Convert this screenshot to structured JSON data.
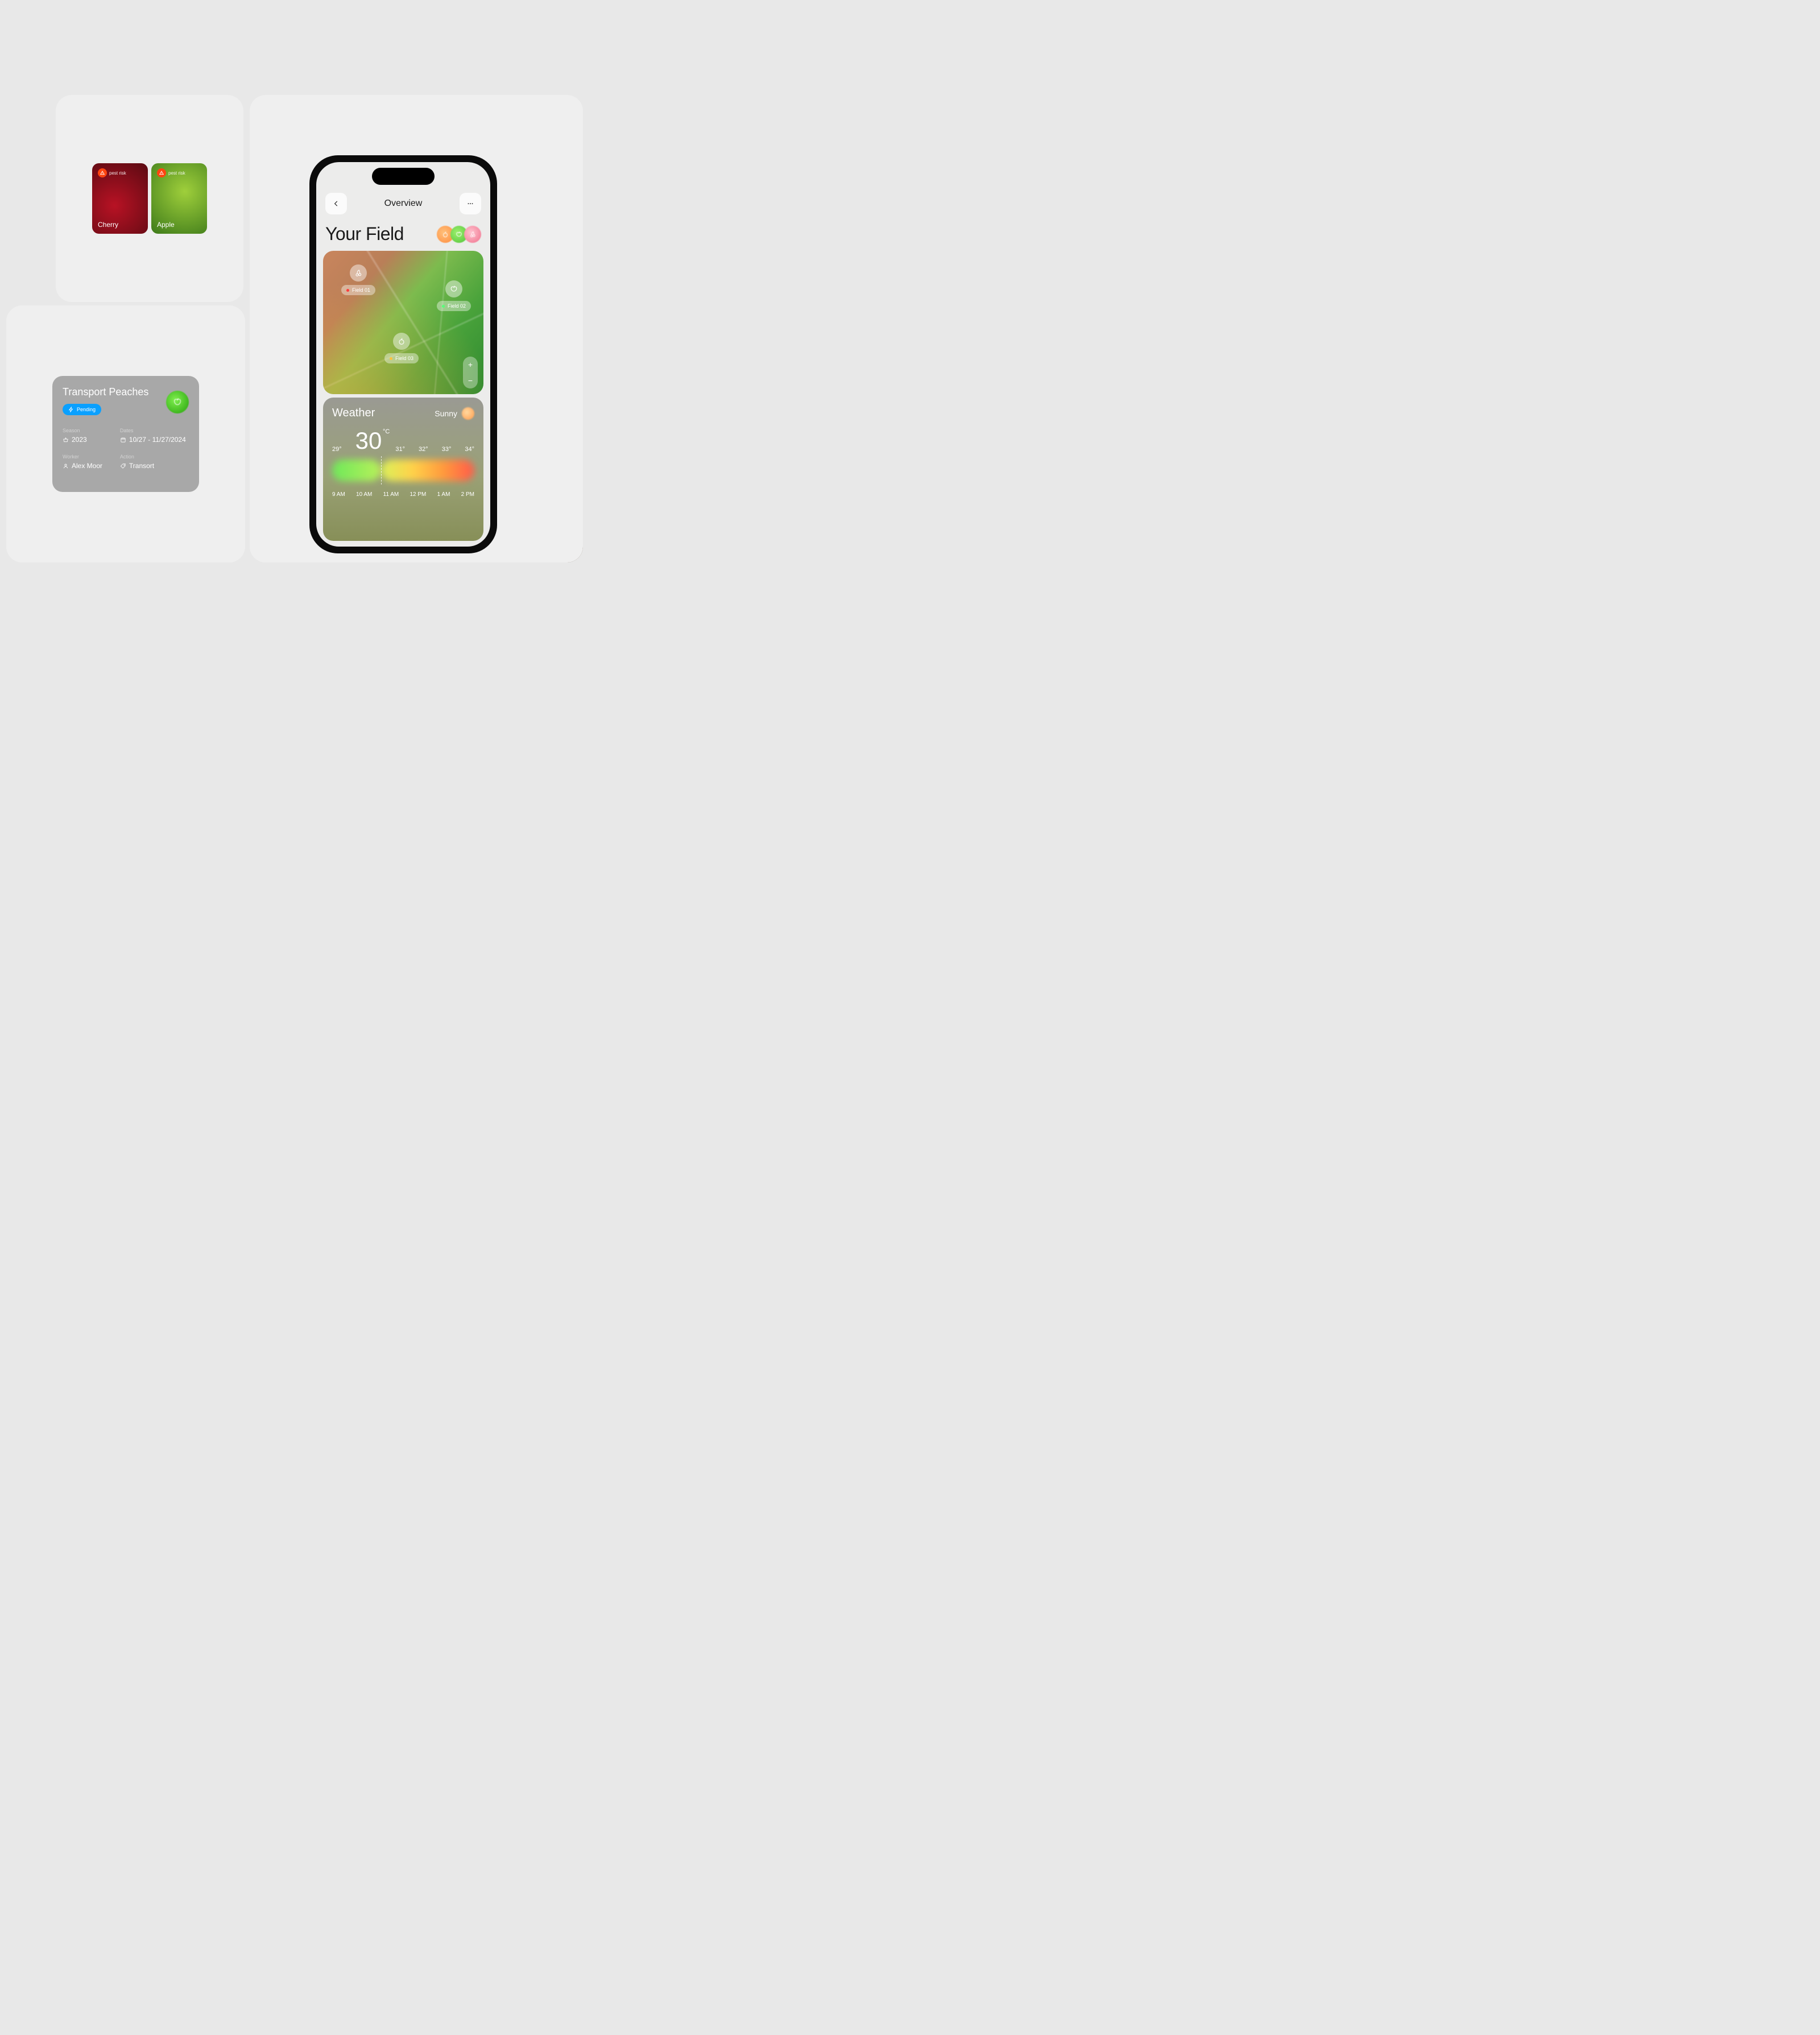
{
  "crops": {
    "risk_label": "pest risk",
    "items": [
      {
        "name": "Cherry"
      },
      {
        "name": "Apple"
      }
    ]
  },
  "task": {
    "title": "Transport Peaches",
    "status": "Pending",
    "fields": {
      "season_label": "Season",
      "season_value": "2023",
      "dates_label": "Dates",
      "dates_value": "10/27 - 11/27/2024",
      "worker_label": "Worker",
      "worker_value": "Alex Moor",
      "action_label": "Action",
      "action_value": "Transort"
    }
  },
  "phone": {
    "header_title": "Overview",
    "heading": "Your Field",
    "fields": [
      {
        "label": "Field 01"
      },
      {
        "label": "Field 02"
      },
      {
        "label": "Field 03"
      }
    ],
    "weather": {
      "title": "Weather",
      "condition": "Sunny",
      "temps": [
        "29°",
        "30",
        "31°",
        "32°",
        "33°",
        "34°"
      ],
      "unit": "°C",
      "hours": [
        "9 AM",
        "10 AM",
        "11 AM",
        "12 PM",
        "1 AM",
        "2 PM"
      ]
    }
  }
}
